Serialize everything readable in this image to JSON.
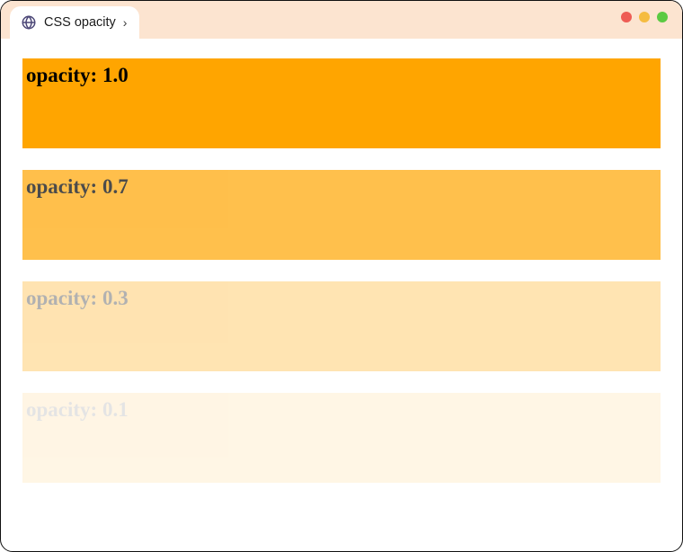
{
  "window": {
    "tab_title": "CSS opacity"
  },
  "boxes": [
    {
      "label": "opacity: 1.0",
      "opacity": 1.0
    },
    {
      "label": "opacity: 0.7",
      "opacity": 0.7
    },
    {
      "label": "opacity: 0.3",
      "opacity": 0.3
    },
    {
      "label": "opacity: 0.1",
      "opacity": 0.1
    }
  ],
  "colors": {
    "titlebar_bg": "#fce4d0",
    "box_bg": "#ffa500"
  }
}
